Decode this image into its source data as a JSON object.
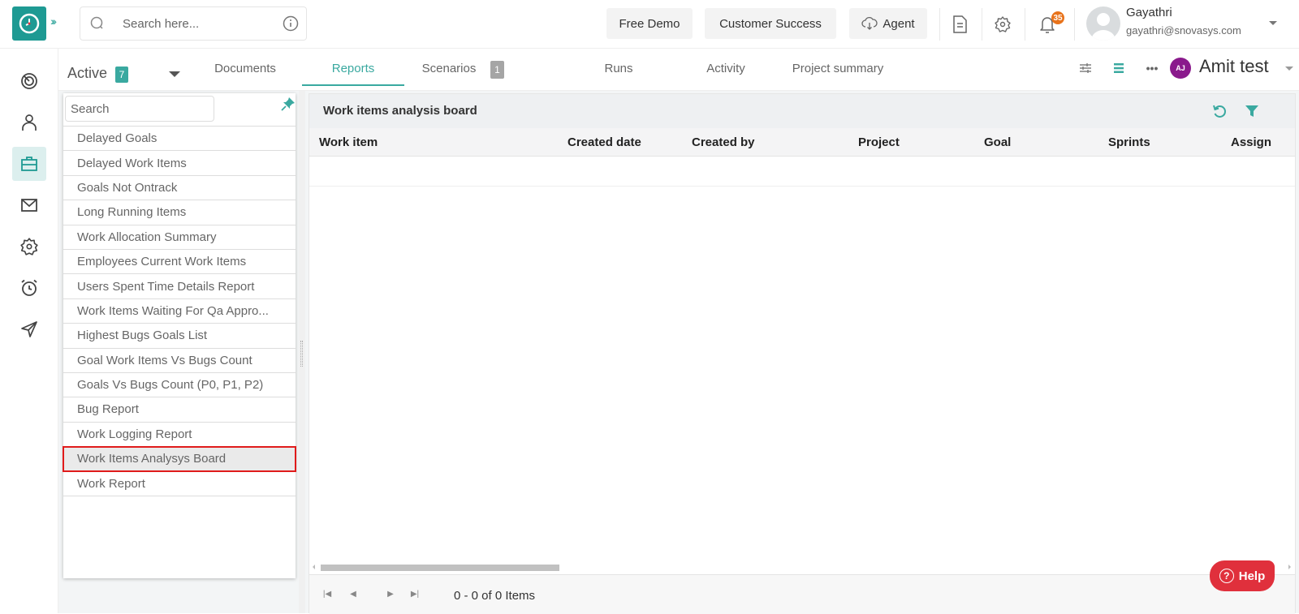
{
  "topbar": {
    "search_placeholder": "Search here...",
    "buttons": {
      "free_demo": "Free Demo",
      "customer_success": "Customer Success",
      "agent": "Agent"
    },
    "notification_count": "35",
    "user": {
      "name": "Gayathri",
      "email": "gayathri@snovasys.com"
    }
  },
  "sidebar": {
    "items": [
      {
        "name": "dashboard",
        "icon": "target-icon",
        "active": false
      },
      {
        "name": "users",
        "icon": "user-icon",
        "active": false
      },
      {
        "name": "projects",
        "icon": "briefcase-icon",
        "active": true
      },
      {
        "name": "messages",
        "icon": "mail-icon",
        "active": false
      },
      {
        "name": "settings",
        "icon": "gear-icon",
        "active": false
      },
      {
        "name": "timesheet",
        "icon": "alarm-clock-icon",
        "active": false
      },
      {
        "name": "send",
        "icon": "send-icon",
        "active": false
      }
    ]
  },
  "project_tabs": {
    "status_label": "Active",
    "status_count": "7",
    "tabs": [
      {
        "label": "Documents",
        "active": false
      },
      {
        "label": "Reports",
        "active": true
      },
      {
        "label": "Scenarios",
        "active": false,
        "badge": "1"
      },
      {
        "label": "Runs",
        "active": false
      },
      {
        "label": "Activity",
        "active": false
      },
      {
        "label": "Project summary",
        "active": false
      }
    ],
    "project_initials": "AJ",
    "project_name": "Amit test",
    "accent_color": "#3aa9a0"
  },
  "reports_panel": {
    "search_placeholder": "Search",
    "items": [
      "Delayed Goals",
      "Delayed Work Items",
      "Goals Not Ontrack",
      "Long Running Items",
      "Work Allocation Summary",
      "Employees Current Work Items",
      "Users Spent Time Details Report",
      "Work Items Waiting For Qa Appro...",
      "Highest Bugs Goals List",
      "Goal Work Items Vs Bugs Count",
      "Goals Vs Bugs Count (P0, P1, P2)",
      "Bug Report",
      "Work Logging Report",
      "Work Items Analysys Board",
      "Work Report"
    ],
    "selected_index": 13
  },
  "board": {
    "title": "Work items analysis board",
    "columns": [
      "Work item",
      "Created date",
      "Created by",
      "Project",
      "Goal",
      "Sprints",
      "Assign"
    ],
    "rows": [],
    "pager_info": "0 - 0 of 0 Items"
  },
  "help": {
    "label": "Help",
    "color": "#e0303c"
  }
}
